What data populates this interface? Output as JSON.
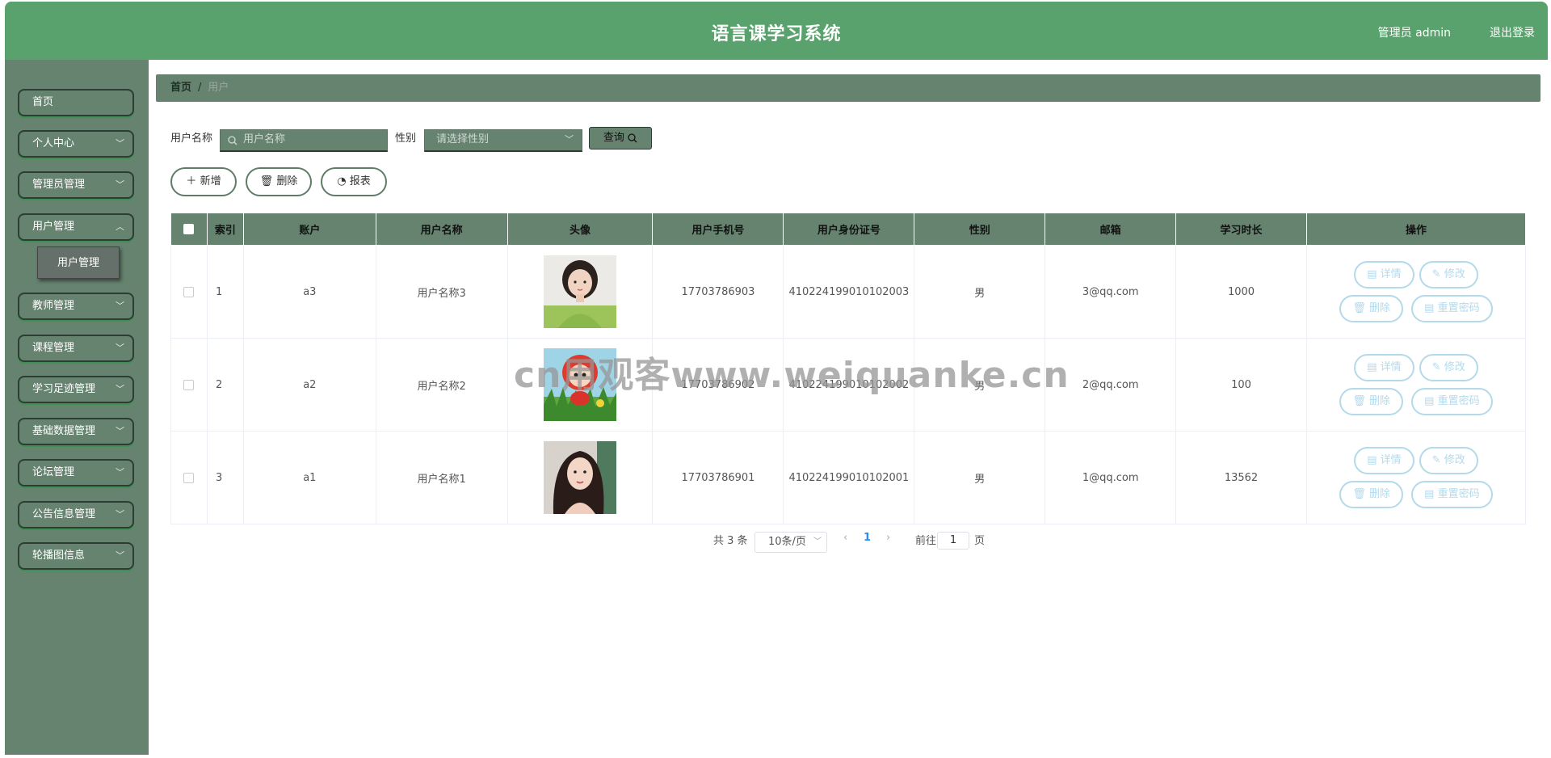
{
  "header": {
    "title": "语言课学习系统",
    "user_label": "管理员 admin",
    "logout_label": "退出登录"
  },
  "sidebar": {
    "items": [
      {
        "label": "首页",
        "has_arrow": false
      },
      {
        "label": "个人中心",
        "has_arrow": true
      },
      {
        "label": "管理员管理",
        "has_arrow": true
      },
      {
        "label": "用户管理",
        "has_arrow": true
      },
      {
        "label": "教师管理",
        "has_arrow": true
      },
      {
        "label": "课程管理",
        "has_arrow": true
      },
      {
        "label": "学习足迹管理",
        "has_arrow": true
      },
      {
        "label": "基础数据管理",
        "has_arrow": true
      },
      {
        "label": "论坛管理",
        "has_arrow": true
      },
      {
        "label": "公告信息管理",
        "has_arrow": true
      },
      {
        "label": "轮播图信息",
        "has_arrow": true
      }
    ],
    "submenu_label": "用户管理"
  },
  "breadcrumb": {
    "home": "首页",
    "separator": "/",
    "current": "用户"
  },
  "search": {
    "name_label": "用户名称",
    "name_placeholder": "用户名称",
    "gender_label": "性别",
    "gender_placeholder": "请选择性别",
    "query_label": "查询"
  },
  "actions": {
    "add_label": "新增",
    "delete_label": "删除",
    "report_label": "报表"
  },
  "table": {
    "columns": [
      "索引",
      "账户",
      "用户名称",
      "头像",
      "用户手机号",
      "用户身份证号",
      "性别",
      "邮箱",
      "学习时长",
      "操作"
    ],
    "rows": [
      {
        "index": "1",
        "account": "a3",
        "name": "用户名称3",
        "phone": "17703786903",
        "id_card": "410224199010102003",
        "gender": "男",
        "email": "3@qq.com",
        "study_time": "1000"
      },
      {
        "index": "2",
        "account": "a2",
        "name": "用户名称2",
        "phone": "17703786902",
        "id_card": "410224199010102002",
        "gender": "男",
        "email": "2@qq.com",
        "study_time": "100"
      },
      {
        "index": "3",
        "account": "a1",
        "name": "用户名称1",
        "phone": "17703786901",
        "id_card": "410224199010102001",
        "gender": "男",
        "email": "1@qq.com",
        "study_time": "13562"
      }
    ],
    "op_labels": {
      "detail": "详情",
      "edit": "修改",
      "delete": "删除",
      "reset": "重置密码"
    }
  },
  "pagination": {
    "total": "共 3 条",
    "page_size": "10条/页",
    "current_page": "1",
    "goto_prefix": "前往",
    "goto_value": "1",
    "goto_suffix": "页"
  },
  "watermark": "cn用观客www.weiquanke.cn",
  "colors": {
    "header": "#5aa26d",
    "sidebar": "#66836f",
    "op_button": "#b4d9ea"
  }
}
